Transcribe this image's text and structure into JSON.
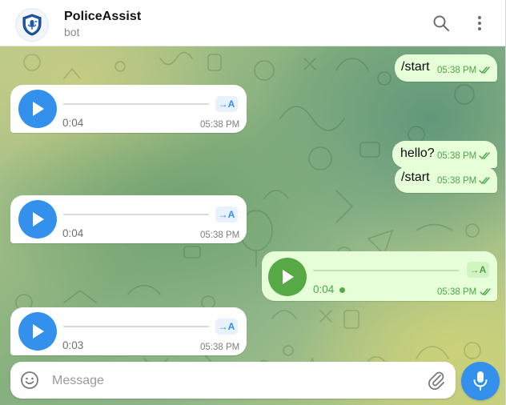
{
  "header": {
    "title": "PoliceAssist",
    "subtitle": "bot",
    "avatar_icon": "police-shield-icon"
  },
  "messages": [
    {
      "type": "text",
      "direction": "outgoing",
      "text": "/start",
      "time": "05:38 PM",
      "status": "read"
    },
    {
      "type": "voice",
      "direction": "incoming",
      "duration": "0:04",
      "time": "05:38 PM",
      "transcribe": "→A"
    },
    {
      "type": "text",
      "direction": "outgoing",
      "text": "hello?",
      "time": "05:38 PM",
      "status": "read"
    },
    {
      "type": "text",
      "direction": "outgoing",
      "text": "/start",
      "time": "05:38 PM",
      "status": "read"
    },
    {
      "type": "voice",
      "direction": "incoming",
      "duration": "0:04",
      "time": "05:38 PM",
      "transcribe": "→A"
    },
    {
      "type": "voice",
      "direction": "outgoing",
      "duration": "0:04",
      "time": "05:38 PM",
      "status": "read",
      "transcribe": "→A",
      "unplayed": true
    },
    {
      "type": "voice",
      "direction": "incoming",
      "duration": "0:03",
      "time": "05:38 PM",
      "transcribe": "→A"
    }
  ],
  "composer": {
    "placeholder": "Message"
  },
  "colors": {
    "accent": "#3390ec",
    "outgoing_bubble": "#e6ffd9",
    "outgoing_text": "#4da548"
  }
}
